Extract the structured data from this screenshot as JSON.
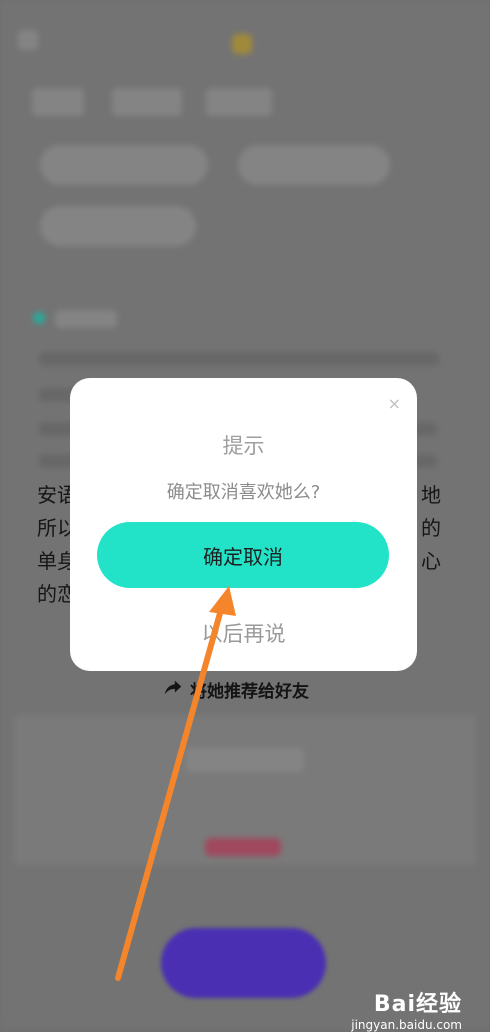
{
  "dialog": {
    "title": "提示",
    "message": "确定取消喜欢她么?",
    "confirm_label": "确定取消",
    "later_label": "以后再说",
    "close_glyph": "×"
  },
  "share": {
    "label": "将她推荐给好友"
  },
  "background_text": {
    "left_fragments": [
      "安语",
      "所以",
      "单身",
      "的恋"
    ],
    "right_fragments": [
      "地",
      "的",
      "心"
    ]
  },
  "watermark": {
    "brand": "Bai经验",
    "url": "jingyan.baidu.com"
  },
  "colors": {
    "accent": "#22e2c8",
    "arrow": "#f5852a",
    "fab": "#4a2fb3"
  },
  "icons": {
    "share": "share-arrow-icon",
    "close": "close-icon"
  }
}
